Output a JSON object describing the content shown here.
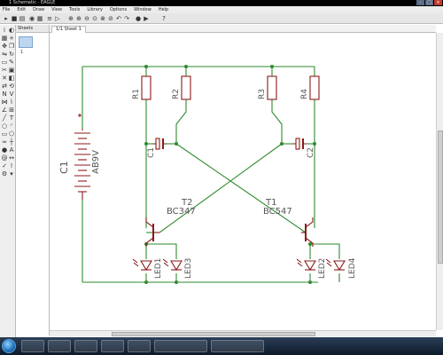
{
  "window": {
    "title": "1 Schematic - EAGLE"
  },
  "menu": [
    "File",
    "Edit",
    "Draw",
    "View",
    "Tools",
    "Library",
    "Options",
    "Window",
    "Help"
  ],
  "sheets_panel": {
    "header": "Sheets",
    "thumb_number": "1"
  },
  "tab": {
    "label": "1/1 Sheet 1"
  },
  "schematic": {
    "refs": {
      "r1": "R1",
      "r2": "R2",
      "r3": "R3",
      "r4": "R4",
      "c1": "C1",
      "c2": "C2",
      "battery": "C1",
      "battery_value": "AB9V",
      "t1": "T1",
      "t2": "T2",
      "t1_value": "BC547",
      "t2_value": "BC347",
      "led1": "LED1",
      "led2": "LED2",
      "led3": "LED3",
      "led4": "LED4"
    }
  },
  "taskbar": {
    "clock": ""
  },
  "colors": {
    "wire": "#2e8b2e",
    "part": "#8b1a1a",
    "label": "#555555"
  }
}
